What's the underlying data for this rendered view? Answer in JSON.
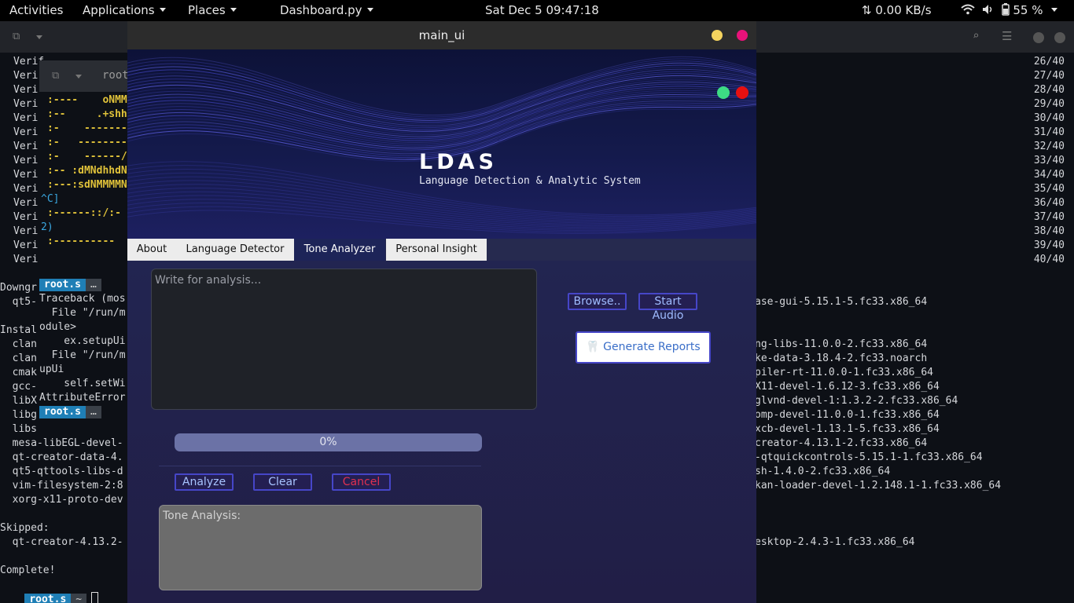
{
  "topbar": {
    "activities": "Activities",
    "applications": "Applications",
    "places": "Places",
    "focused_app": "Dashboard.py",
    "clock": "Sat Dec 5  09:47:18",
    "net_speed": "0.00 KB/s",
    "battery": "55 %"
  },
  "terminal": {
    "left_lines": [
      "Verif",
      "Veri",
      "Veri",
      "Veri",
      "Veri",
      "Veri",
      "Veri",
      "Veri",
      "Veri",
      "Veri",
      "Veri",
      "Veri",
      "Veri",
      "Veri",
      "Veri"
    ],
    "counters": [
      "26/40",
      "27/40",
      "28/40",
      "29/40",
      "30/40",
      "31/40",
      "32/40",
      "33/40",
      "34/40",
      "35/40",
      "36/40",
      "37/40",
      "38/40",
      "39/40",
      "40/40"
    ],
    "downgr": "Downgr",
    "qt5": "  qt5-",
    "instal": "Instal",
    "pkg_left": [
      "  clan",
      "  clan",
      "  cmak",
      "  gcc-",
      "  libX",
      "  libg",
      "  libs",
      "  mesa-libEGL-devel-",
      "  qt-creator-data-4.",
      "  qt5-qttools-libs-d",
      "  vim-filesystem-2:8",
      "  xorg-x11-proto-dev"
    ],
    "pkg_right": [
      "ase-gui-5.15.1-5.fc33.x86_64",
      "ng-libs-11.0.0-2.fc33.x86_64",
      "ke-data-3.18.4-2.fc33.noarch",
      "piler-rt-11.0.0-1.fc33.x86_64",
      "X11-devel-1.6.12-3.fc33.x86_64",
      "glvnd-devel-1:1.3.2-2.fc33.x86_64",
      "omp-devel-11.0.0-1.fc33.x86_64",
      "xcb-devel-1.13.1-5.fc33.x86_64",
      "creator-4.13.1-2.fc33.x86_64",
      "-qtquickcontrols-5.15.1-1.fc33.x86_64",
      "sh-1.4.0-2.fc33.x86_64",
      "kan-loader-devel-1.2.148.1-1.fc33.x86_64"
    ],
    "skipped": "Skipped:",
    "skipped_left": "  qt-creator-4.13.2-",
    "skipped_right": "esktop-2.4.3-1.fc33.x86_64",
    "complete": "Complete!",
    "prompt_user": "root.s",
    "prompt_path": "~",
    "prompt_dots": "…"
  },
  "terminal2": {
    "title": "root",
    "ascii_lines": [
      ":----    oNMM",
      ":--     .+shh",
      ":-    -------",
      ":-   --------",
      ":-    ------/",
      ":-- :dMNdhhdN",
      ":---:sdNMMMMN"
    ],
    "ctrl_c": "^C]",
    "ascii_line_2": ":------::/:-",
    "paren_line": "2)",
    "ascii_line_3": ":----------",
    "traceback": [
      "Traceback (mos",
      "  File \"/run/m",
      "odule>",
      "    ex.setupUi",
      "  File \"/run/m",
      "upUi",
      "    self.setWi",
      "AttributeError"
    ]
  },
  "window": {
    "title": "main_ui",
    "app_name": "LDAS",
    "app_subtitle": "Language Detection & Analytic System",
    "tabs": [
      "About",
      "Language Detector",
      "Tone Analyzer",
      "Personal Insight"
    ],
    "active_tab": "Tone Analyzer",
    "input_placeholder": "Write for analysis...",
    "browse_label": "Browse..",
    "start_audio_label": "Start Audio",
    "generate_reports_label": "Generate Reports",
    "progress_value": 0,
    "progress_label": "0%",
    "analyze_label": "Analyze",
    "clear_label": "Clear",
    "cancel_label": "Cancel",
    "tone_output_label": "Tone Analysis:"
  },
  "colors": {
    "accent_blue": "#4646c8",
    "cancel_red": "#e03050",
    "window_bg": "#211e45",
    "banner_dark": "#0d1238",
    "minimize_yellow": "#f4d35e",
    "close_pink": "#e8127a",
    "status_green": "#3ddc84",
    "status_red": "#e81010"
  }
}
